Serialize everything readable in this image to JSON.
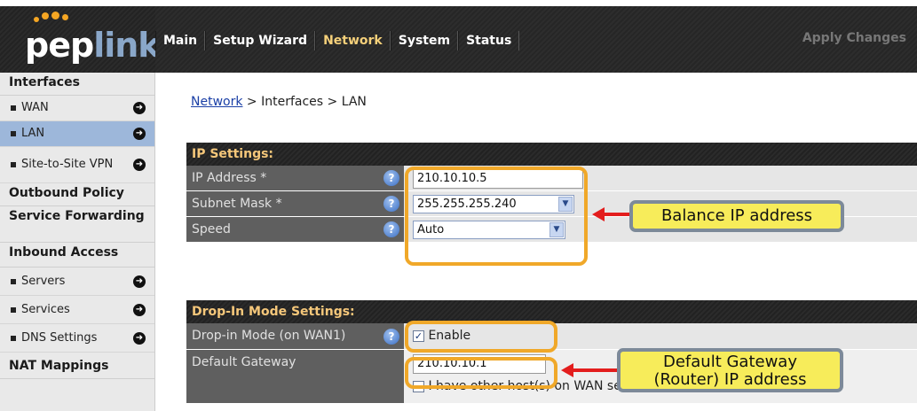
{
  "brand": {
    "logo_part1": "pep",
    "logo_part2": "link"
  },
  "menu": {
    "items": [
      {
        "label": "Main"
      },
      {
        "label": "Setup Wizard"
      },
      {
        "label": "Network"
      },
      {
        "label": "System"
      },
      {
        "label": "Status"
      }
    ],
    "active": "Network",
    "apply_label": "Apply Changes"
  },
  "sidebar": {
    "interfaces": "Interfaces",
    "wan": "WAN",
    "lan": "LAN",
    "site_to_site": "Site-to-Site VPN",
    "outbound_policy": "Outbound Policy",
    "service_forwarding": "Service Forwarding",
    "inbound_access": "Inbound Access",
    "servers": "Servers",
    "services": "Services",
    "dns_settings": "DNS Settings",
    "nat_mappings": "NAT Mappings"
  },
  "breadcrumb": {
    "link": "Network",
    "rest": " > Interfaces > LAN"
  },
  "ip_settings": {
    "title": "IP Settings:",
    "ip_label": "IP Address *",
    "ip_value": "210.10.10.5",
    "subnet_label": "Subnet Mask *",
    "subnet_value": "255.255.255.240",
    "speed_label": "Speed",
    "speed_value": "Auto"
  },
  "dropin": {
    "title": "Drop-In Mode Settings:",
    "mode_label": "Drop-in Mode (on WAN1)",
    "enable_label": "Enable",
    "enable_checked": true,
    "gateway_label": "Default Gateway",
    "gateway_value": "210.10.10.1",
    "other_hosts_label": "I have other host(s) on WAN segment"
  },
  "callouts": {
    "balance": "Balance IP address",
    "gateway_line1": "Default Gateway",
    "gateway_line2": "(Router) IP address"
  },
  "colors": {
    "accent_orange": "#f0a829",
    "callout_yellow": "#f7ec5a",
    "arrow_red": "#e31d1d",
    "active_nav": "#9db7da"
  },
  "help_glyph": "?"
}
